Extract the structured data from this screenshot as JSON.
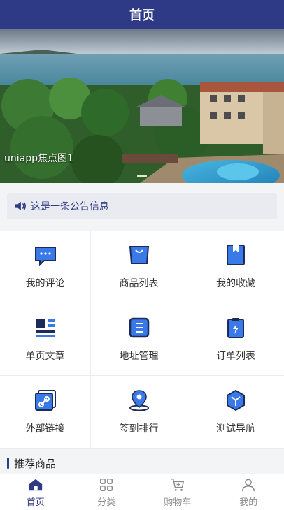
{
  "header": {
    "title": "首页"
  },
  "banner": {
    "caption": "uniapp焦点图1"
  },
  "notice": {
    "text": "这是一条公告信息"
  },
  "grid": [
    {
      "label": "我的评论",
      "icon": "comment-icon"
    },
    {
      "label": "商品列表",
      "icon": "shopping-bag-icon"
    },
    {
      "label": "我的收藏",
      "icon": "bookmark-icon"
    },
    {
      "label": "单页文章",
      "icon": "article-icon"
    },
    {
      "label": "地址管理",
      "icon": "address-icon"
    },
    {
      "label": "订单列表",
      "icon": "order-list-icon"
    },
    {
      "label": "外部链接",
      "icon": "link-icon"
    },
    {
      "label": "签到排行",
      "icon": "location-pin-icon"
    },
    {
      "label": "测试导航",
      "icon": "hexagon-icon"
    }
  ],
  "section": {
    "title": "推荐商品"
  },
  "tabbar": [
    {
      "label": "首页",
      "icon": "home-icon",
      "active": true
    },
    {
      "label": "分类",
      "icon": "category-icon",
      "active": false
    },
    {
      "label": "购物车",
      "icon": "cart-icon",
      "active": false
    },
    {
      "label": "我的",
      "icon": "user-icon",
      "active": false
    }
  ],
  "colors": {
    "primary": "#2e3a86",
    "accent": "#3a7ae8"
  }
}
